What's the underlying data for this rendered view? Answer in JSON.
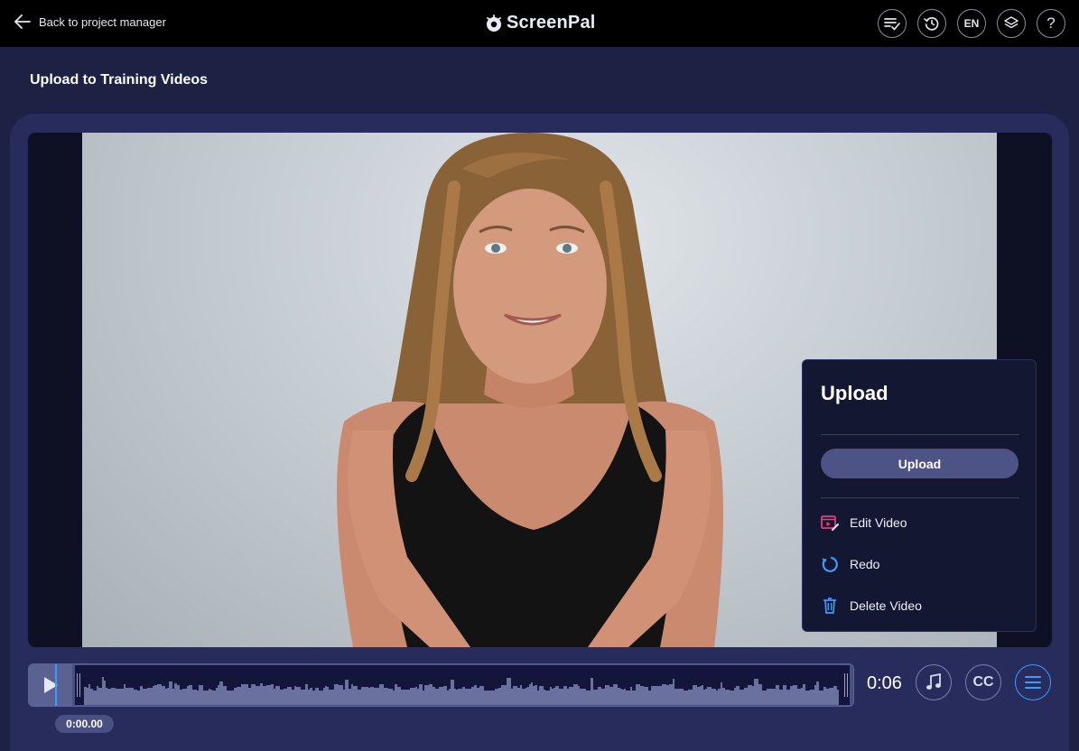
{
  "header": {
    "back_label": "Back to project manager",
    "logo_text": "ScreenPal",
    "lang_label": "EN",
    "help_label": "?",
    "icons": [
      "checklist-icon",
      "history-icon",
      "language-button",
      "layers-icon",
      "help-icon"
    ]
  },
  "page": {
    "title": "Upload to Training Videos"
  },
  "menu": {
    "title": "Upload",
    "upload_button": "Upload",
    "items": [
      {
        "label": "Edit Video",
        "icon": "edit-video-icon",
        "color": "#e63c7a"
      },
      {
        "label": "Redo",
        "icon": "redo-icon",
        "color": "#3b9cff"
      },
      {
        "label": "Delete Video",
        "icon": "trash-icon",
        "color": "#3b9cff"
      }
    ]
  },
  "player": {
    "current_time": "0:00.00",
    "duration": "0:06",
    "cc_label": "CC",
    "accent": "#3b9cff"
  }
}
